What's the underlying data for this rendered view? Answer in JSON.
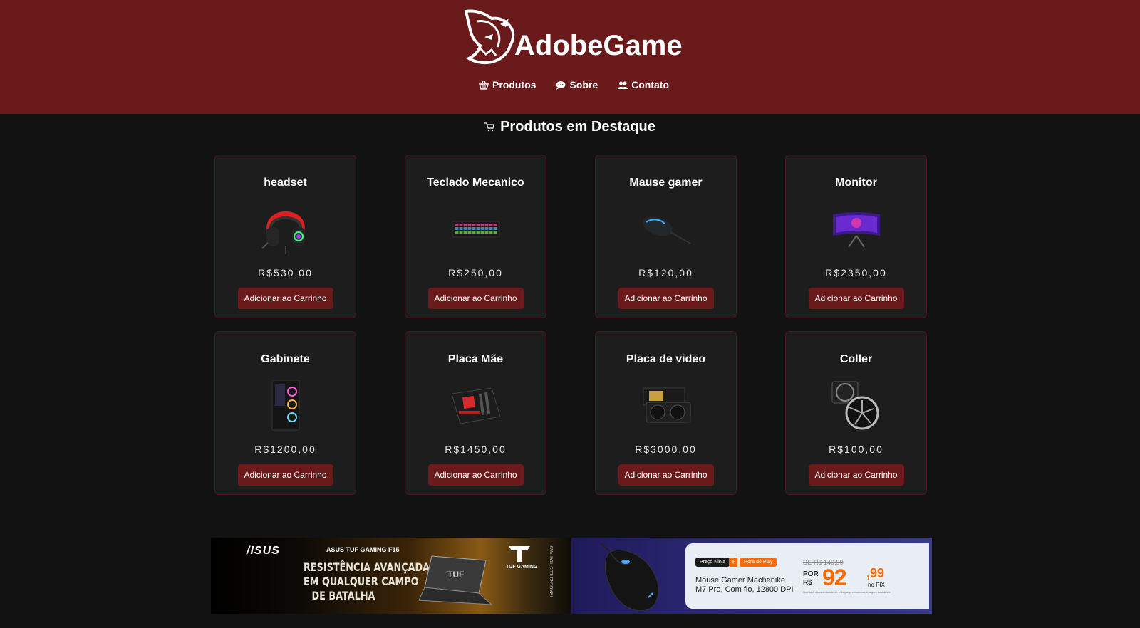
{
  "colors": {
    "header_bg": "#6a1a1b",
    "page_bg": "#121212",
    "card_bg": "#1d1d1d",
    "accent_orange": "#ff6a00"
  },
  "header": {
    "logo_icon": "panther-head-icon",
    "brand": "AdobeGame",
    "nav": [
      {
        "icon": "basket-icon",
        "label": "Produtos"
      },
      {
        "icon": "chat-bubble-icon",
        "label": "Sobre"
      },
      {
        "icon": "people-icon",
        "label": "Contato"
      }
    ]
  },
  "main": {
    "section_icon": "cart-icon",
    "section_title": "Produtos em Destaque",
    "button_label": "Adicionar ao Carrinho",
    "products": [
      {
        "name": "headset",
        "price": "R$530,00",
        "image_icon": "headset-image"
      },
      {
        "name": "Teclado Mecanico",
        "price": "R$250,00",
        "image_icon": "keyboard-image"
      },
      {
        "name": "Mause gamer",
        "price": "R$120,00",
        "image_icon": "mouse-image"
      },
      {
        "name": "Monitor",
        "price": "R$2350,00",
        "image_icon": "monitor-image"
      },
      {
        "name": "Gabinete",
        "price": "R$1200,00",
        "image_icon": "pc-case-image"
      },
      {
        "name": "Placa Mãe",
        "price": "R$1450,00",
        "image_icon": "motherboard-image"
      },
      {
        "name": "Placa de video",
        "price": "R$3000,00",
        "image_icon": "gpu-image"
      },
      {
        "name": "Coller",
        "price": "R$100,00",
        "image_icon": "cooler-image"
      }
    ]
  },
  "banners": {
    "asus": {
      "logo": "/ISUS",
      "model": "ASUS TUF GAMING F15",
      "headline": [
        "RESISTÊNCIA AVANÇADA",
        "EM QUALQUER CAMPO",
        "DE BATALHA"
      ],
      "tuf_label": "TUF GAMING",
      "side_label": "IMAGENS ILUSTRATIVAS"
    },
    "mouse": {
      "tag_ninja": "Preço Ninja",
      "tag_plus": "+",
      "tag_hora": "Hora do Play",
      "title": "Mouse Gamer Machenike M7 Pro, Com fio, 12800 DPI",
      "old_price": "DE R$ 149,99",
      "por": "POR",
      "currency": "R$",
      "price_int": "92",
      "price_cents": ",99",
      "payment": "no PIX",
      "note": "Sujeito à disponibilidade de estoque promocional. Imagem ilustrativa."
    }
  }
}
